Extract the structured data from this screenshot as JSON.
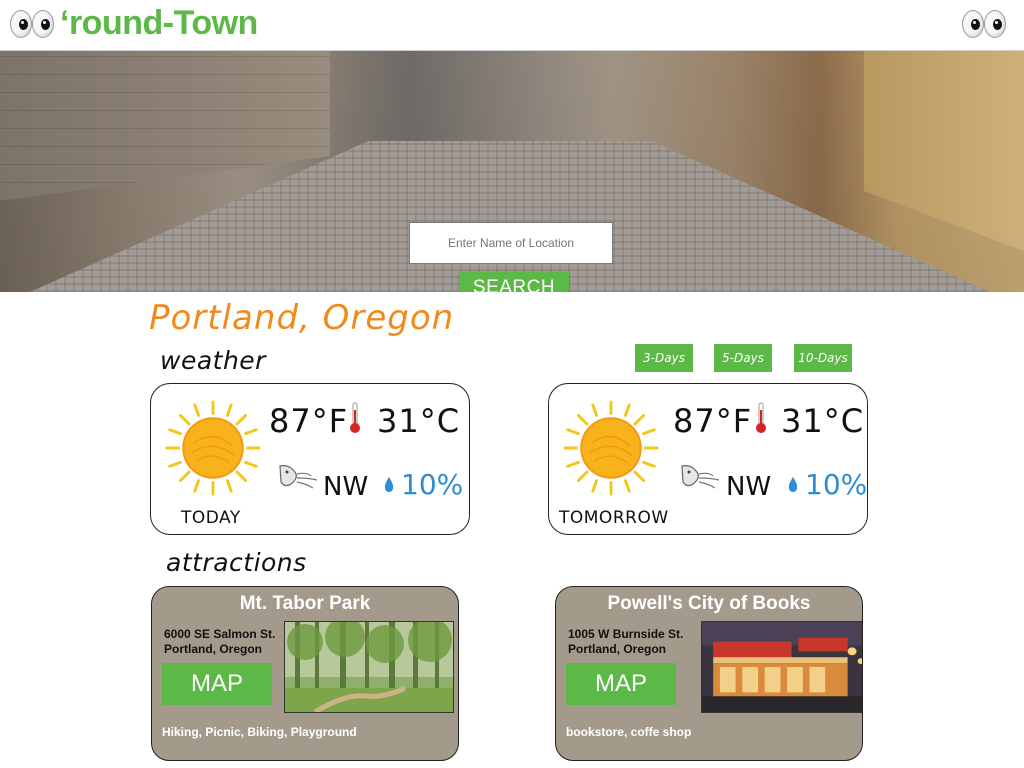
{
  "header": {
    "title": "‘round-Town",
    "left_logo_icon": "eyes-icon",
    "right_menu_icon": "eyes-icon",
    "brand_color": "#5cb847"
  },
  "hero": {
    "image": "cobblestone-street",
    "search": {
      "placeholder": "Enter Name of Location",
      "value": "",
      "button_label": "SEARCH"
    }
  },
  "location": {
    "name": "Portland, Oregon",
    "color": "#f08a1c"
  },
  "weather": {
    "heading": "weather",
    "forecast_buttons": [
      "3-Days",
      "5-Days",
      "10-Days"
    ],
    "cards": [
      {
        "day": "TODAY",
        "icon": "sun-icon",
        "temp_f": "87°F",
        "temp_c": "31°C",
        "wind_dir": "NW",
        "precip": "10%"
      },
      {
        "day": "TOMORROW",
        "icon": "sun-icon",
        "temp_f": "87°F",
        "temp_c": "31°C",
        "wind_dir": "NW",
        "precip": "10%"
      }
    ]
  },
  "attractions": {
    "heading": "attractions",
    "map_label": "MAP",
    "items": [
      {
        "name": "Mt. Tabor Park",
        "address_line1": "6000 SE Salmon St.",
        "address_line2": "Portland, Oregon",
        "tags": "Hiking, Picnic, Biking, Playground",
        "photo": "forest-park-photo"
      },
      {
        "name": "Powell's City of Books",
        "address_line1": "1005 W Burnside St.",
        "address_line2": "Portland, Oregon",
        "tags": "bookstore, coffe shop",
        "photo": "bookstore-storefront-photo"
      }
    ]
  }
}
